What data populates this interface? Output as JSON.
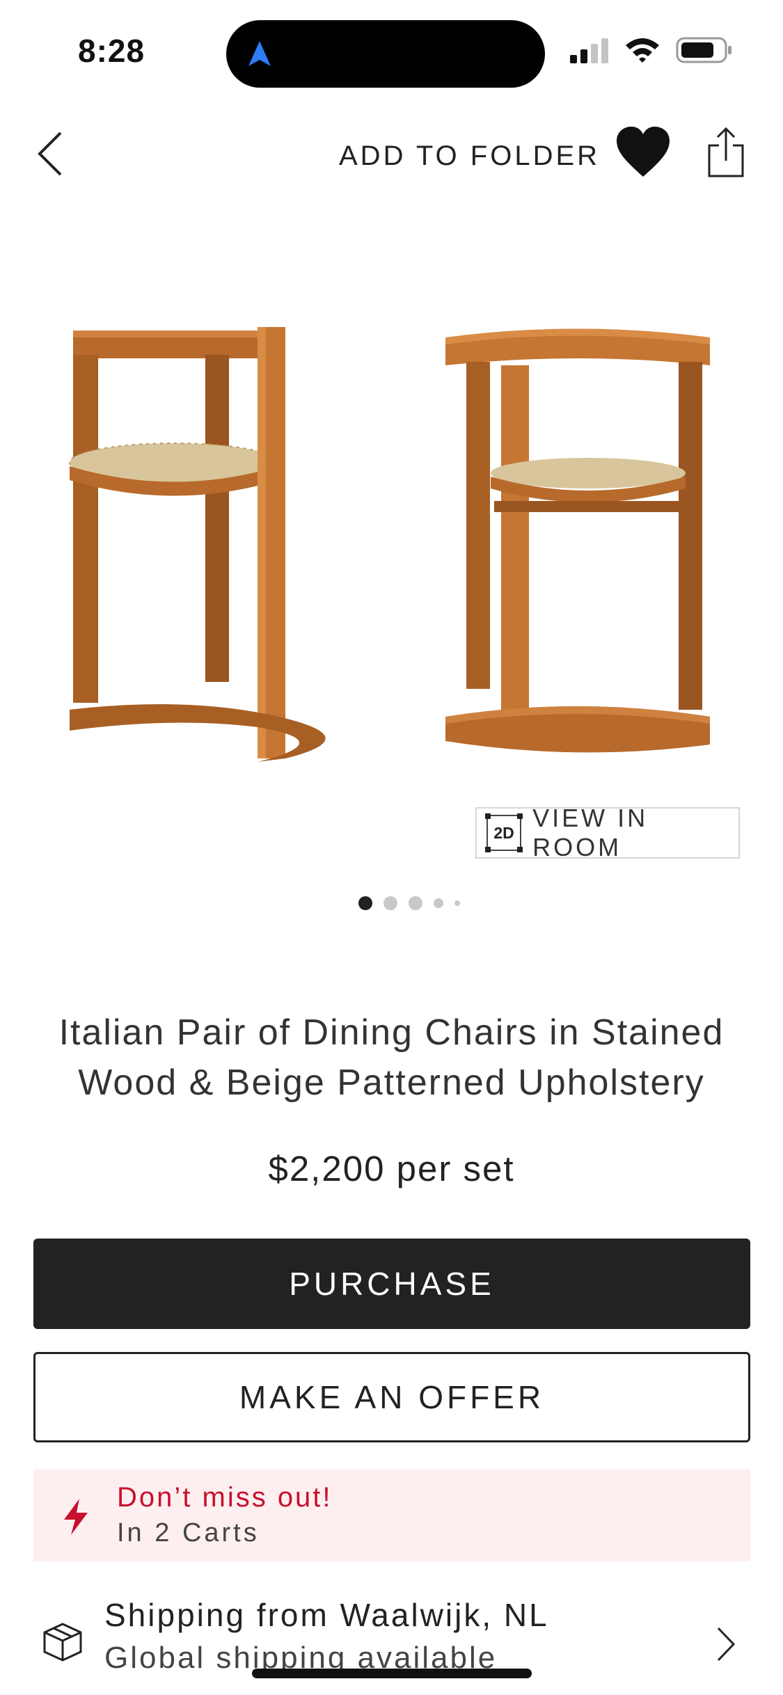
{
  "status_bar": {
    "time": "8:28",
    "icons": [
      "location-arrow-icon",
      "cellular-signal-icon",
      "wifi-icon",
      "battery-icon"
    ]
  },
  "top_nav": {
    "back_icon": "chevron-left-icon",
    "add_to_folder_label": "ADD TO FOLDER",
    "favorite_icon": "heart-icon",
    "share_icon": "share-icon"
  },
  "gallery": {
    "image_alt": "Italian Pair of Dining Chairs",
    "view_in_room_badge": "2D",
    "view_in_room_label": "VIEW IN ROOM",
    "page_count": 5,
    "active_page": 1
  },
  "product": {
    "title": "Italian Pair of Dining Chairs in Stained Wood & Beige Patterned Upholstery",
    "price": "$2,200 per set"
  },
  "actions": {
    "purchase_label": "PURCHASE",
    "offer_label": "MAKE AN OFFER"
  },
  "alert": {
    "icon": "lightning-icon",
    "title": "Don’t miss out!",
    "subtitle": "In 2 Carts"
  },
  "shipping": {
    "icon": "package-icon",
    "title": "Shipping from Waalwijk, NL",
    "subtitle": "Global shipping available",
    "chevron_icon": "chevron-right-icon"
  },
  "colors": {
    "primary_button": "#222222",
    "alert_background": "#fdefef",
    "alert_red": "#c8102e",
    "wood": "#b76a2b",
    "wood_dark": "#8e4c18",
    "upholstery": "#d9c59b"
  }
}
